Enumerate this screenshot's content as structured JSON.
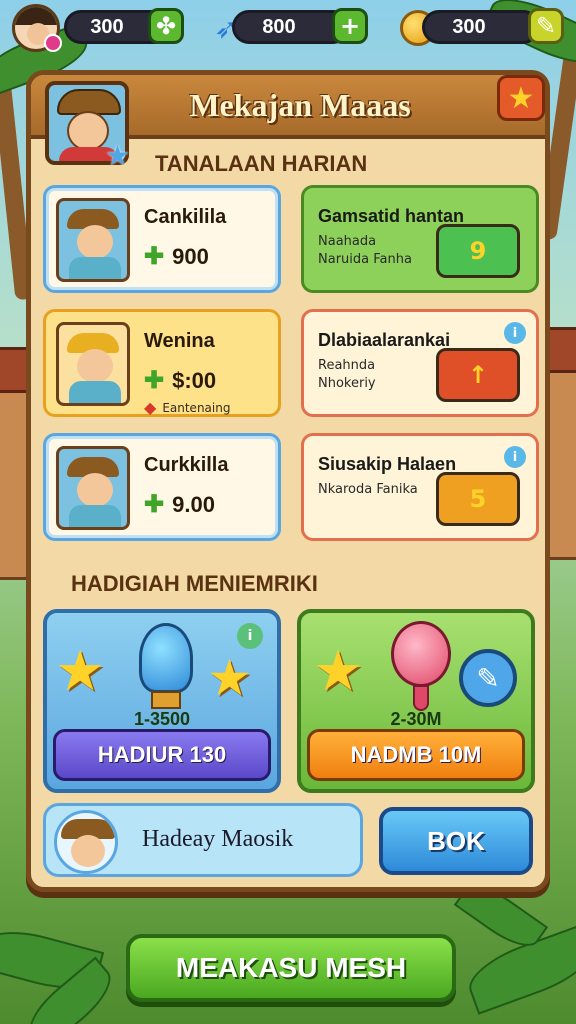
{
  "resources": {
    "first": "300",
    "second": "800",
    "third": "300"
  },
  "header": {
    "title": "Mekajan Maaas"
  },
  "daily_tasks": {
    "section_title": "TANALAAN HARIAN",
    "cards": [
      {
        "title": "Cankilila",
        "reward": "900"
      },
      {
        "title": "Gamsatid hantan",
        "line_a": "Naahada",
        "line_b": "Naruida Fanha"
      },
      {
        "title": "Wenina",
        "reward": "$:00",
        "sub": "Eantenaing"
      },
      {
        "title": "Dlabiaalarankai",
        "line_a": "Reahnda",
        "line_b": "Nhokeriy"
      },
      {
        "title": "Curkkilla",
        "reward": "9.00"
      },
      {
        "title": "Siusakip Halaen",
        "line_a": "Nkaroda Fanika"
      }
    ]
  },
  "gifts": {
    "section_title": "HADIGIAH MENIEMRIKI",
    "cards": [
      {
        "value": "1-3500",
        "button": "HADIUR 130"
      },
      {
        "value": "2-30M",
        "button": "NADMB 10M"
      }
    ]
  },
  "friend": {
    "name": "Hadeay Maosik",
    "action": "BOK"
  },
  "main_action": "MEAKASU MESH"
}
